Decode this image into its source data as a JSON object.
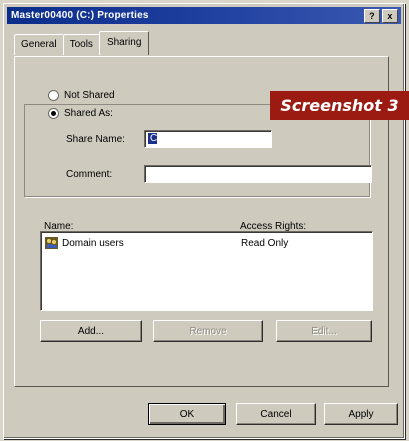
{
  "window": {
    "title": "Master00400 (C:) Properties"
  },
  "titlebar_buttons": [
    "?",
    "x"
  ],
  "tabs": [
    {
      "label": "General",
      "active": false
    },
    {
      "label": "Tools",
      "active": false
    },
    {
      "label": "Sharing",
      "active": true
    }
  ],
  "sharing": {
    "not_shared_label": "Not Shared",
    "shared_as_label": "Shared As:",
    "selected_option": "shared_as",
    "share_name_label": "Share Name:",
    "share_name_value": "C",
    "comment_label": "Comment:",
    "comment_value": ""
  },
  "overlay_badge": "Screenshot 3",
  "permissions": {
    "col_name": "Name:",
    "col_rights": "Access Rights:",
    "rows": [
      {
        "name": "Domain users",
        "rights": "Read Only"
      }
    ]
  },
  "list_buttons": {
    "add": "Add...",
    "remove": "Remove",
    "edit": "Edit..."
  },
  "dialog_buttons": {
    "ok": "OK",
    "cancel": "Cancel",
    "apply": "Apply"
  },
  "colors": {
    "title_bar": "#0b2d8a",
    "badge": "#9b1a12",
    "dialog_face": "#cfcabe"
  }
}
